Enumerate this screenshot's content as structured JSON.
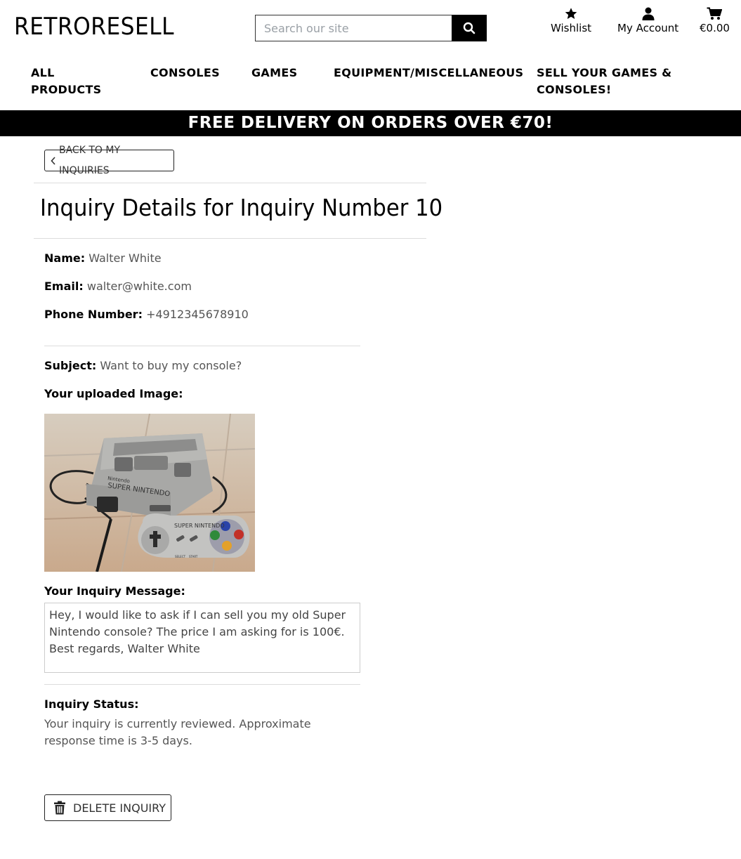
{
  "header": {
    "logo": "RETRORESELL",
    "search_placeholder": "Search our site",
    "wishlist_label": "Wishlist",
    "account_label": "My Account",
    "cart_total": "€0.00"
  },
  "nav": {
    "items": [
      {
        "label_line1": "ALL",
        "label_line2": "PRODUCTS"
      },
      {
        "label_line1": "CONSOLES",
        "label_line2": ""
      },
      {
        "label_line1": "GAMES",
        "label_line2": ""
      },
      {
        "label_line1": "EQUIPMENT/MISCELLANEOUS",
        "label_line2": ""
      },
      {
        "label_line1": "SELL YOUR GAMES &",
        "label_line2": "CONSOLES!"
      }
    ]
  },
  "banner": "FREE DELIVERY ON ORDERS OVER €70!",
  "inquiry": {
    "back_label": "BACK TO MY INQUIRIES",
    "title": "Inquiry Details for Inquiry Number 10",
    "name_label": "Name:",
    "name": "Walter White",
    "email_label": "Email:",
    "email": "walter@white.com",
    "phone_label": "Phone Number:",
    "phone": "+4912345678910",
    "subject_label": "Subject:",
    "subject": "Want to buy my console?",
    "image_label": "Your uploaded Image:",
    "message_label": "Your Inquiry Message:",
    "message": "Hey, I would like to ask if I can sell you my old Super Nintendo console? The price I am asking for is 100€. Best regards, Walter White",
    "status_label": "Inquiry Status:",
    "status_text": "Your inquiry is currently reviewed. Approximate response time is 3-5 days.",
    "delete_label": "DELETE INQUIRY"
  },
  "image_print": {
    "console_brand": "SUPER NINTENDO",
    "console_maker": "Nintendo",
    "controller_brand": "SUPER NINTENDO",
    "select": "SELECT",
    "start": "START"
  },
  "colors": {
    "banner_bg": "#000000",
    "banner_text": "#ffffff"
  }
}
